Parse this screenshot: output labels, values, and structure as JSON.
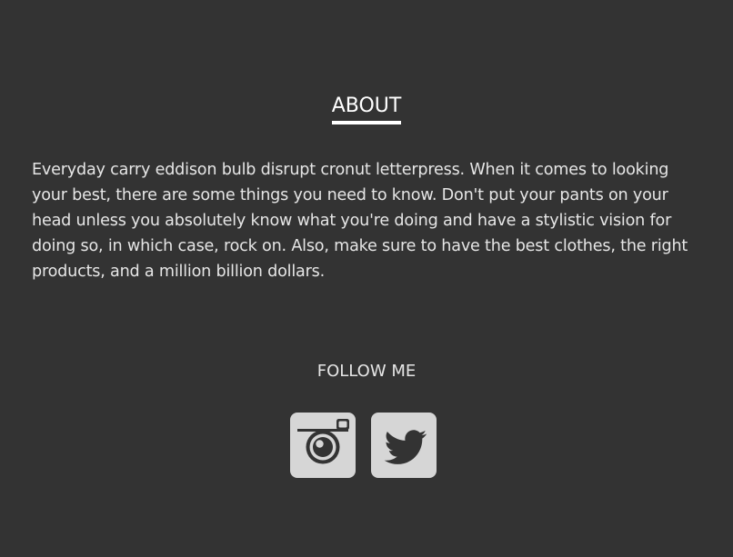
{
  "about": {
    "heading": "ABOUT",
    "text": "Everyday carry eddison bulb disrupt cronut letterpress. When it comes to looking your best, there are some things you need to know. Don't put your pants on your head unless you absolutely know what you're doing and have a stylistic vision for doing so, in which case, rock on. Also, make sure to have the best clothes, the right products, and a million billion dollars."
  },
  "follow": {
    "heading": "FOLLOW ME",
    "links": [
      {
        "name": "instagram",
        "icon": "instagram-icon"
      },
      {
        "name": "twitter",
        "icon": "twitter-icon"
      }
    ]
  },
  "colors": {
    "background": "#333333",
    "text": "#e6e6e6",
    "icon_tile": "#d6d6d6",
    "icon_glyph": "#333333"
  }
}
